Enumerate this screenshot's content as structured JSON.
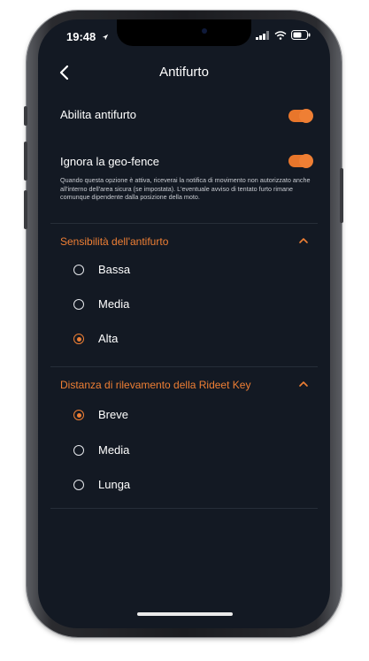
{
  "status_bar": {
    "time": "19:48",
    "icons": [
      "location-arrow-icon",
      "signal-icon",
      "wifi-icon",
      "battery-icon"
    ]
  },
  "header": {
    "title": "Antifurto",
    "back_icon": "chevron-left-icon"
  },
  "settings": {
    "enable_label": "Abilita antifurto",
    "enable_on": true,
    "geofence_label": "Ignora la geo-fence",
    "geofence_on": true,
    "geofence_description": "Quando questa opzione è attiva, riceverai la notifica di movimento non autorizzato anche all'interno dell'area sicura (se impostata). L'eventuale avviso di tentato furto rimane comunque dipendente dalla posizione della moto."
  },
  "sections": [
    {
      "title": "Sensibilità dell'antifurto",
      "expanded": true,
      "options": [
        {
          "label": "Bassa",
          "selected": false
        },
        {
          "label": "Media",
          "selected": false
        },
        {
          "label": "Alta",
          "selected": true
        }
      ]
    },
    {
      "title": "Distanza di rilevamento della Rideet Key",
      "expanded": true,
      "options": [
        {
          "label": "Breve",
          "selected": true
        },
        {
          "label": "Media",
          "selected": false
        },
        {
          "label": "Lunga",
          "selected": false
        }
      ]
    }
  ],
  "colors": {
    "accent": "#ef7f34",
    "background": "#131923",
    "text": "#ffffff"
  }
}
